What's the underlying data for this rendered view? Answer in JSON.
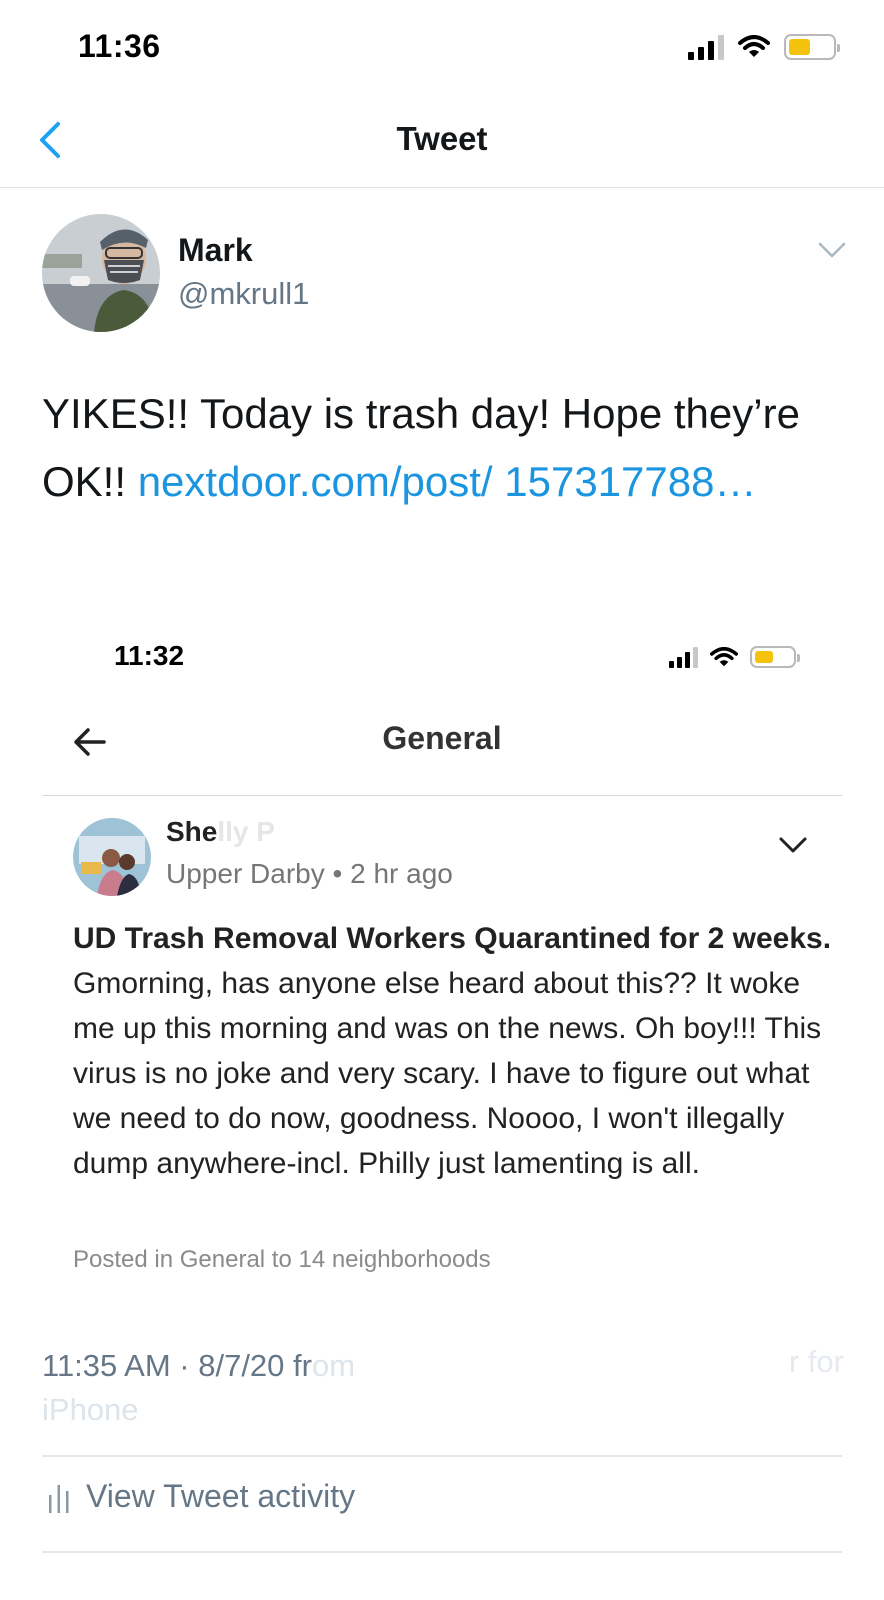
{
  "status_bar": {
    "time": "11:36",
    "battery_color": "#f4c20d"
  },
  "nav": {
    "title": "Tweet",
    "back_icon": "chevron-left-icon"
  },
  "tweet": {
    "author_name": "Mark",
    "author_handle": "@mkrull1",
    "text_plain": "YIKES!! Today is trash day! Hope they’re OK!! ",
    "text_link": "nextdoor.com/post/ 157317788…",
    "link_color": "#1b95e0",
    "timestamp": "11:35 AM · 8/7/20 fr",
    "timestamp_faded": "om",
    "source_tail": "r for",
    "source_device": "iPhone",
    "activity_label": "View Tweet activity"
  },
  "embedded_screenshot": {
    "time": "11:32",
    "title": "General",
    "poster_name_visible": "She",
    "poster_name_faded": "lly P",
    "poster_location": "Upper Darby",
    "separator": " • ",
    "poster_time": "2 hr ago",
    "post_title": "UD Trash Removal Workers Quarantined for 2 weeks.",
    "post_body": " Gmorning, has anyone else heard about this??  It woke me up this morning and was on the news.  Oh boy!!!  This virus is no joke and very scary.  I have to figure out what we need to do now, goodness.  Noooo, I won't illegally dump anywhere-incl. Philly just lamenting is all.",
    "posted_in": "Posted in General to 14 neighborhoods"
  }
}
